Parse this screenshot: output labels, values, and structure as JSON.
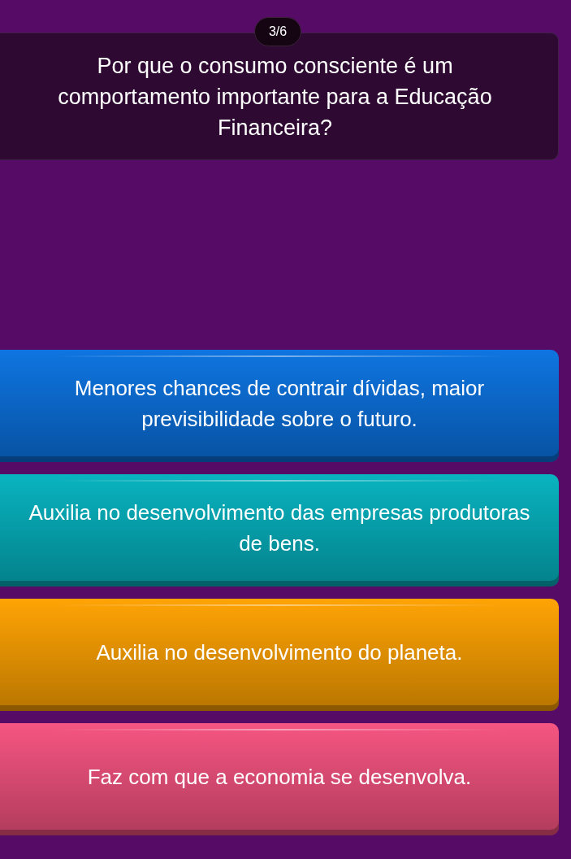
{
  "question": {
    "counter": "3/6",
    "text": "Por que o consumo consciente é um comportamento importante para a Educação Financeira?"
  },
  "options": [
    {
      "text": "Menores chances de contrair dívidas, maior previsibilidade sobre o futuro.",
      "color": "#0a72e0"
    },
    {
      "text": "Auxilia no desenvolvimento das empresas produtoras de bens.",
      "color": "#04b2bf"
    },
    {
      "text": "Auxilia no desenvolvimento do planeta.",
      "color": "#ffa200"
    },
    {
      "text": "Faz com que a economia se desenvolva.",
      "color": "#f5527f"
    }
  ]
}
